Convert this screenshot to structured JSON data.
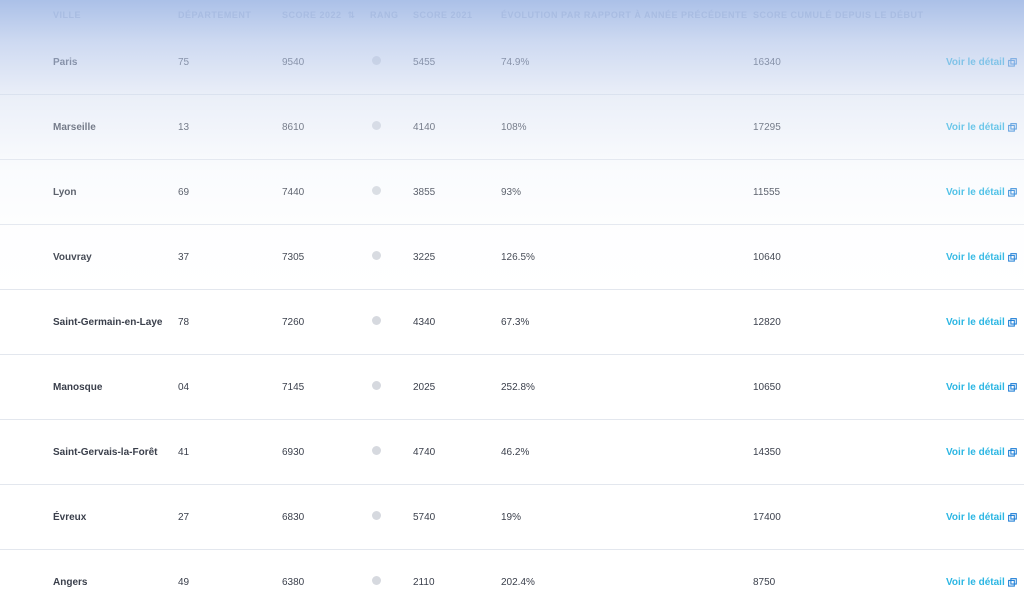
{
  "headers": {
    "city": "VILLE",
    "department": "DÉPARTEMENT",
    "score_2022": "SCORE 2022",
    "rank": "RANG",
    "score_2021": "SCORE 2021",
    "evolution": "ÉVOLUTION PAR RAPPORT À ANNÉE PRÉCÉDENTE",
    "cumulative": "SCORE CUMULÉ DEPUIS LE DÉBUT"
  },
  "link_label": "Voir le détail",
  "colors": {
    "link": "#2bb6e3",
    "rank_dot": "#d6d9df",
    "header_overlay": "#9db6e4"
  },
  "icons": {
    "sort": "sort-icon",
    "external": "external-link-icon"
  },
  "rows": [
    {
      "city": "Paris",
      "department": "75",
      "score_2022": "9540",
      "score_2021": "5455",
      "evolution": "74.9%",
      "cumulative": "16340"
    },
    {
      "city": "Marseille",
      "department": "13",
      "score_2022": "8610",
      "score_2021": "4140",
      "evolution": "108%",
      "cumulative": "17295"
    },
    {
      "city": "Lyon",
      "department": "69",
      "score_2022": "7440",
      "score_2021": "3855",
      "evolution": "93%",
      "cumulative": "11555"
    },
    {
      "city": "Vouvray",
      "department": "37",
      "score_2022": "7305",
      "score_2021": "3225",
      "evolution": "126.5%",
      "cumulative": "10640"
    },
    {
      "city": "Saint-Germain-en-Laye",
      "department": "78",
      "score_2022": "7260",
      "score_2021": "4340",
      "evolution": "67.3%",
      "cumulative": "12820"
    },
    {
      "city": "Manosque",
      "department": "04",
      "score_2022": "7145",
      "score_2021": "2025",
      "evolution": "252.8%",
      "cumulative": "10650"
    },
    {
      "city": "Saint-Gervais-la-Forêt",
      "department": "41",
      "score_2022": "6930",
      "score_2021": "4740",
      "evolution": "46.2%",
      "cumulative": "14350"
    },
    {
      "city": "Évreux",
      "department": "27",
      "score_2022": "6830",
      "score_2021": "5740",
      "evolution": "19%",
      "cumulative": "17400"
    },
    {
      "city": "Angers",
      "department": "49",
      "score_2022": "6380",
      "score_2021": "2110",
      "evolution": "202.4%",
      "cumulative": "8750"
    }
  ]
}
